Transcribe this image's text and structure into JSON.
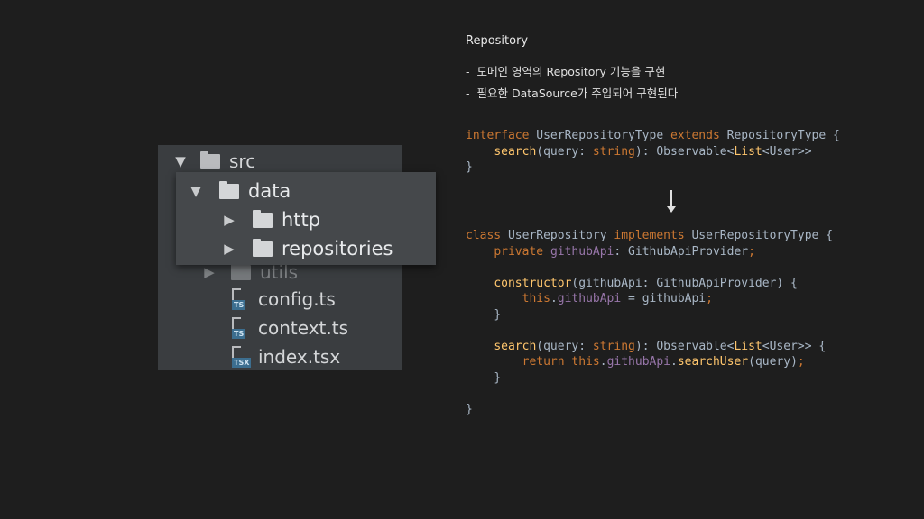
{
  "file_tree": {
    "src": "src",
    "data": "data",
    "http": "http",
    "repositories": "repositories",
    "utils": "utils",
    "files": [
      {
        "name": "config.ts",
        "badge": "TS"
      },
      {
        "name": "context.ts",
        "badge": "TS"
      },
      {
        "name": "index.tsx",
        "badge": "TSX"
      }
    ]
  },
  "notes": {
    "title": "Repository",
    "bullets": [
      "도메인 영역의 Repository 기능을 구현",
      "필요한 DataSource가 주입되어 구현된다"
    ]
  },
  "code": {
    "interface": {
      "l1_kw": "interface",
      "l1_rest": " UserRepositoryType ",
      "l1_kw2": "extends",
      "l1_rest2": " RepositoryType {",
      "l2_fn": "search",
      "l2_a": "(query: ",
      "l2_kw": "string",
      "l2_b": "): Observable<",
      "l2_type": "List",
      "l2_c": "<User>>",
      "l3": "}"
    },
    "class": {
      "l1_kw": "class",
      "l1_rest": " UserRepository ",
      "l1_kw2": "implements",
      "l1_rest2": " UserRepositoryType {",
      "l2_kw": "private",
      "l2_prop": "githubApi",
      "l2_rest": ": GithubApiProvider",
      "l2_semi": ";",
      "l4_fn": "constructor",
      "l4_rest": "(githubApi: GithubApiProvider) {",
      "l5_kw": "this",
      "l5_dot": ".",
      "l5_prop": "githubApi",
      "l5_rest": " = githubApi",
      "l5_semi": ";",
      "l6": "}",
      "l8_fn": "search",
      "l8_a": "(query: ",
      "l8_kw": "string",
      "l8_b": "): Observable<",
      "l8_type": "List",
      "l8_c": "<User>> {",
      "l9_kw": "return",
      "l9_kw2": "this",
      "l9_dot": ".",
      "l9_prop": "githubApi",
      "l9_dot2": ".",
      "l9_fn": "searchUser",
      "l9_rest": "(query)",
      "l9_semi": ";",
      "l10": "}",
      "l12": "}"
    }
  },
  "colors": {
    "keyword": "#cc7832",
    "function": "#ffc66d",
    "property": "#9876aa",
    "text": "#a9b7c6",
    "ts_badge": "#3c6e8f"
  }
}
